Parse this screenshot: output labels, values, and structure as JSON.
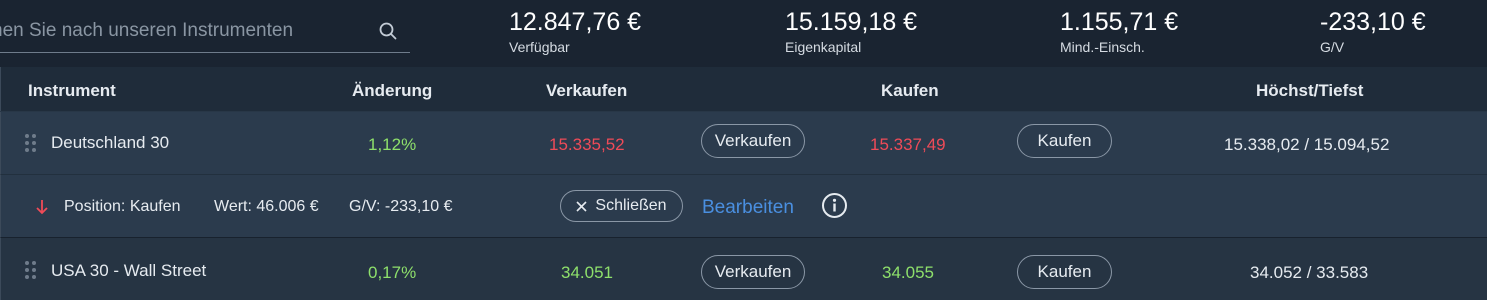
{
  "search": {
    "placeholder": "hen Sie nach unseren Instrumenten",
    "icon": "search-icon"
  },
  "stats": [
    {
      "value": "12.847,76 €",
      "label": "Verfügbar"
    },
    {
      "value": "15.159,18 €",
      "label": "Eigenkapital"
    },
    {
      "value": "1.155,71 €",
      "label": "Mind.-Einsch."
    },
    {
      "value": "-233,10 €",
      "label": "G/V"
    }
  ],
  "columns": {
    "instrument": "Instrument",
    "change": "Änderung",
    "sell": "Verkaufen",
    "buy": "Kaufen",
    "highlow": "Höchst/Tiefst"
  },
  "rows": [
    {
      "name": "Deutschland 30",
      "change": "1,12%",
      "sell_price": "15.335,52",
      "sell_button": "Verkaufen",
      "buy_price": "15.337,49",
      "buy_button": "Kaufen",
      "highlow": "15.338,02 / 15.094,52"
    },
    {
      "name": "USA 30 - Wall Street",
      "change": "0,17%",
      "sell_price": "34.051",
      "sell_button": "Verkaufen",
      "buy_price": "34.055",
      "buy_button": "Kaufen",
      "highlow": "34.052 / 33.583"
    }
  ],
  "position": {
    "direction_icon": "arrow-down-icon",
    "label": "Position: Kaufen",
    "value": "Wert: 46.006 €",
    "pl": "G/V: -233,10 €",
    "close_icon": "close-icon",
    "close_label": "Schließen",
    "edit_label": "Bearbeiten",
    "info_icon": "info-icon"
  },
  "colors": {
    "positive": "#8ee06b",
    "negative": "#ef4b58",
    "link": "#4a8fe0",
    "background": "#1c2836"
  }
}
